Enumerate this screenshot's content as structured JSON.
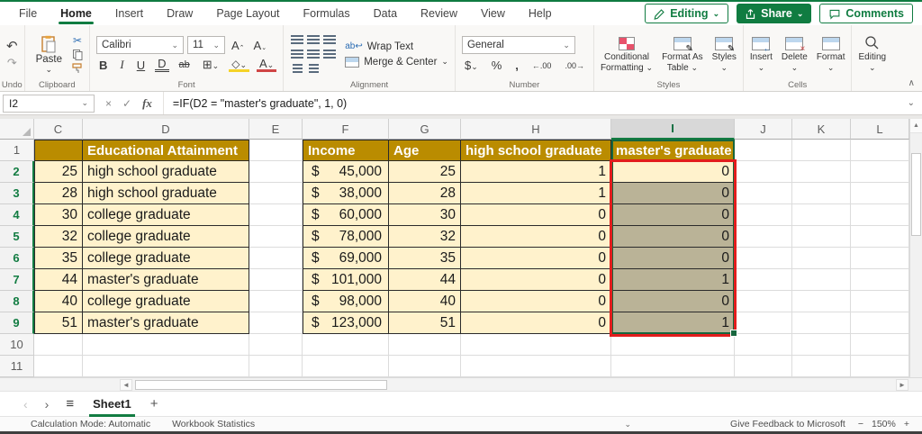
{
  "titlebar": {
    "tabs": [
      "File",
      "Home",
      "Insert",
      "Draw",
      "Page Layout",
      "Formulas",
      "Data",
      "Review",
      "View",
      "Help"
    ],
    "active_tab": "Home",
    "editing_button": "Editing",
    "share_button": "Share",
    "comments_button": "Comments"
  },
  "ribbon": {
    "group_labels": {
      "undo": "Undo",
      "clipboard": "Clipboard",
      "font": "Font",
      "alignment": "Alignment",
      "number": "Number",
      "styles": "Styles",
      "cells": "Cells"
    },
    "paste": "Paste",
    "font_name": "Calibri",
    "font_size": "11",
    "wrap_text": "Wrap Text",
    "merge_center": "Merge & Center",
    "number_format": "General",
    "conditional_1": "Conditional",
    "conditional_2": "Formatting",
    "format_table_1": "Format As",
    "format_table_2": "Table",
    "styles_button": "Styles",
    "insert": "Insert",
    "delete": "Delete",
    "format": "Format",
    "editing": "Editing"
  },
  "formula_bar": {
    "name_box": "I2",
    "formula": "=IF(D2 = \"master's graduate\", 1, 0)"
  },
  "grid": {
    "col_letters": [
      "C",
      "D",
      "E",
      "F",
      "G",
      "H",
      "I",
      "J",
      "K",
      "L"
    ],
    "selected_col": "I",
    "row_numbers": [
      "1",
      "2",
      "3",
      "4",
      "5",
      "6",
      "7",
      "8",
      "9",
      "10",
      "11"
    ],
    "selected_rows": [
      2,
      3,
      4,
      5,
      6,
      7,
      8,
      9
    ],
    "header": {
      "d": "Educational Attainment",
      "f": "Income",
      "g": "Age",
      "h": "high school graduate",
      "i": "master's graduate"
    },
    "currency_symbol": "$",
    "rows": [
      {
        "n": "2",
        "c": "25",
        "d": "high school graduate",
        "f": "45,000",
        "g": "25",
        "h": "1",
        "i": "0"
      },
      {
        "n": "3",
        "c": "28",
        "d": "high school graduate",
        "f": "38,000",
        "g": "28",
        "h": "1",
        "i": "0"
      },
      {
        "n": "4",
        "c": "30",
        "d": "college graduate",
        "f": "60,000",
        "g": "30",
        "h": "0",
        "i": "0"
      },
      {
        "n": "5",
        "c": "32",
        "d": "college graduate",
        "f": "78,000",
        "g": "32",
        "h": "0",
        "i": "0"
      },
      {
        "n": "6",
        "c": "35",
        "d": "college graduate",
        "f": "69,000",
        "g": "35",
        "h": "0",
        "i": "0"
      },
      {
        "n": "7",
        "c": "44",
        "d": "master's graduate",
        "f": "101,000",
        "g": "44",
        "h": "0",
        "i": "1"
      },
      {
        "n": "8",
        "c": "40",
        "d": "college graduate",
        "f": "98,000",
        "g": "40",
        "h": "0",
        "i": "0"
      },
      {
        "n": "9",
        "c": "51",
        "d": "master's graduate",
        "f": "123,000",
        "g": "51",
        "h": "0",
        "i": "1"
      }
    ]
  },
  "sheet_bar": {
    "sheet_name": "Sheet1"
  },
  "status_bar": {
    "calc_mode": "Calculation Mode: Automatic",
    "workbook_stats": "Workbook Statistics",
    "feedback": "Give Feedback to Microsoft",
    "zoom_level": "150%"
  },
  "colors": {
    "excel_green": "#107C41",
    "header_gold": "#BA8C00",
    "cell_cream": "#FFF2CC",
    "selection_tint": "#BAB397",
    "annotation_red": "#E21D1D"
  }
}
